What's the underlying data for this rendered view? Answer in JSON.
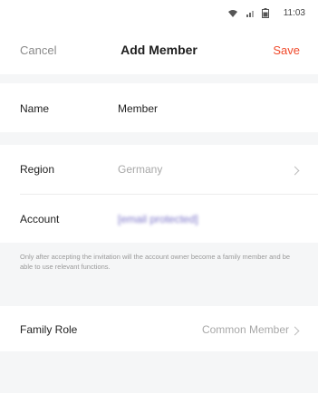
{
  "status_bar": {
    "time": "11:03",
    "icons": [
      "wifi-icon",
      "signal-icon",
      "battery-icon"
    ]
  },
  "nav": {
    "cancel_label": "Cancel",
    "title": "Add Member",
    "save_label": "Save"
  },
  "form": {
    "name": {
      "label": "Name",
      "value": "Member"
    },
    "region": {
      "label": "Region",
      "value": "Germany"
    },
    "account": {
      "label": "Account",
      "value": "[email protected]"
    },
    "hint": "Only after accepting the invitation will the account owner become a family member and be able to use relevant functions.",
    "family_role": {
      "label": "Family Role",
      "value": "Common Member"
    }
  },
  "colors": {
    "accent": "#f04a2b",
    "background": "#f5f6f7",
    "muted_text": "#9a9a9a"
  }
}
